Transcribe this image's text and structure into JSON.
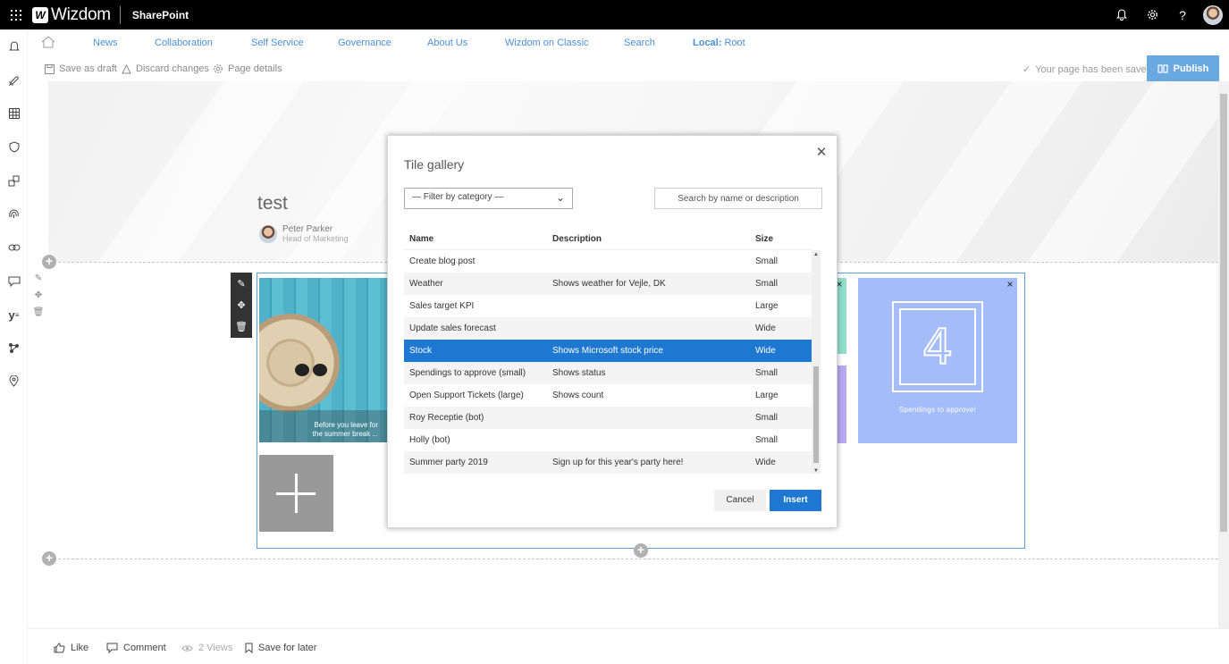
{
  "suitebar": {
    "logo": "Wizdom",
    "app_name": "SharePoint"
  },
  "topnav": {
    "items": [
      {
        "label": "News"
      },
      {
        "label": "Collaboration"
      },
      {
        "label": "Self Service"
      },
      {
        "label": "Governance"
      },
      {
        "label": "About Us"
      },
      {
        "label": "Wizdom on Classic"
      },
      {
        "label": "Search"
      }
    ],
    "local_prefix": "Local:",
    "local_site": "Root"
  },
  "commandbar": {
    "save_draft": "Save as draft",
    "discard": "Discard changes",
    "page_details": "Page details",
    "saved_status": "Your page has been saved",
    "publish": "Publish"
  },
  "page": {
    "title": "test",
    "author_name": "Peter Parker",
    "author_role": "Head of Marketing"
  },
  "tiles": {
    "photo_caption_line1": "Before you leave for",
    "photo_caption_line2": "the summer break ...",
    "kpi_number": "4",
    "kpi_label": "Spendings to approve!"
  },
  "footer": {
    "like": "Like",
    "comment": "Comment",
    "views": "2 Views",
    "save_later": "Save for later"
  },
  "dialog": {
    "title": "Tile gallery",
    "filter_label": "— Filter by category —",
    "search_placeholder": "Search by name or description",
    "columns": {
      "name": "Name",
      "description": "Description",
      "size": "Size"
    },
    "rows": [
      {
        "name": "Create blog post",
        "description": "",
        "size": "Small"
      },
      {
        "name": "Weather",
        "description": "Shows weather for Vejle, DK",
        "size": "Small"
      },
      {
        "name": "Sales target KPI",
        "description": "",
        "size": "Large"
      },
      {
        "name": "Update sales forecast",
        "description": "",
        "size": "Wide"
      },
      {
        "name": "Stock",
        "description": "Shows Microsoft stock price",
        "size": "Wide"
      },
      {
        "name": "Spendings to approve (small)",
        "description": "Shows status",
        "size": "Small"
      },
      {
        "name": "Open Support Tickets (large)",
        "description": "Shows count",
        "size": "Large"
      },
      {
        "name": "Roy Receptie (bot)",
        "description": "",
        "size": "Small"
      },
      {
        "name": "Holly (bot)",
        "description": "",
        "size": "Small"
      },
      {
        "name": "Summer party 2019",
        "description": "Sign up for this year's party here!",
        "size": "Wide"
      }
    ],
    "selected_index": 4,
    "cancel": "Cancel",
    "insert": "Insert"
  },
  "colors": {
    "accent": "#1e78d2",
    "nav_link": "#4a90d9",
    "publish_bg": "#6aa8e0",
    "tile_blue": "#a4bdfa",
    "tile_green": "#90dec9",
    "tile_purple": "#b8a8f0"
  }
}
